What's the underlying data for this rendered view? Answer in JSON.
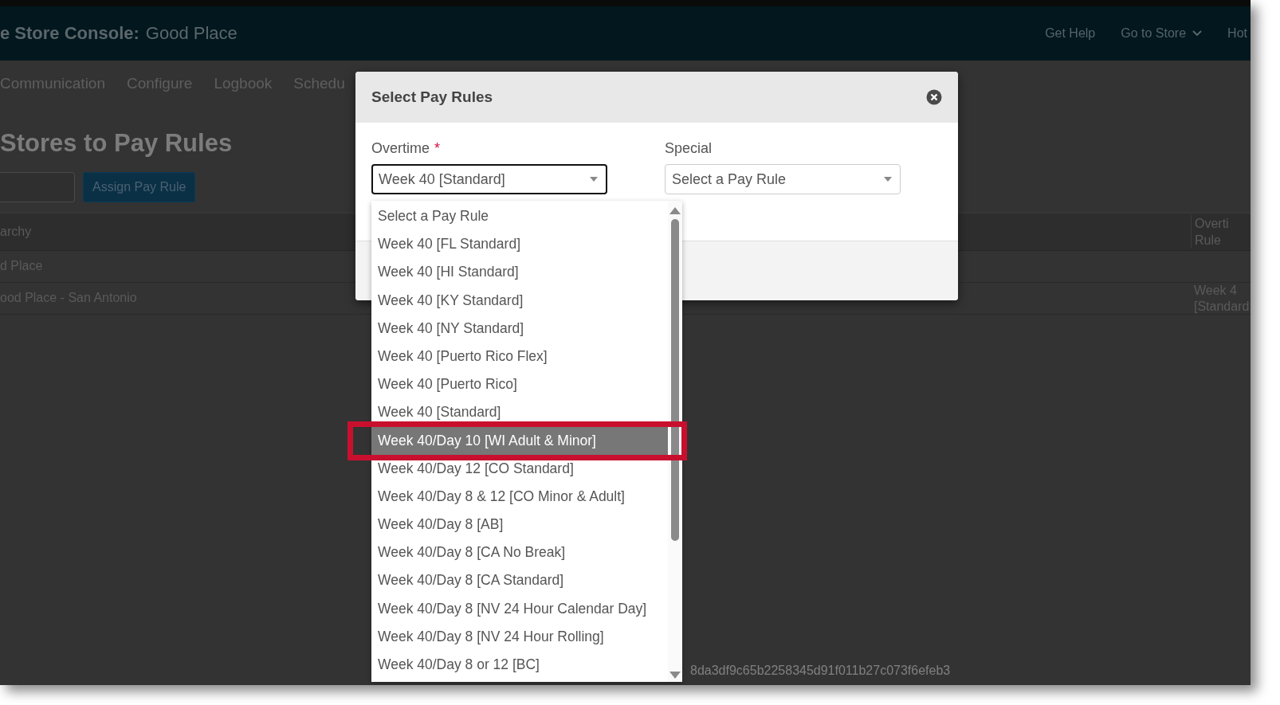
{
  "header": {
    "title_prefix": "e Store Console:",
    "title_store": "Good Place",
    "links": [
      {
        "label": "Get Help",
        "dropdown": false
      },
      {
        "label": "Go to Store",
        "dropdown": true
      },
      {
        "label": "Hot",
        "dropdown": false
      }
    ]
  },
  "nav": [
    {
      "label": "Communication"
    },
    {
      "label": "Configure"
    },
    {
      "label": "Logbook"
    },
    {
      "label": "Schedu"
    }
  ],
  "page_title": "Stores to Pay Rules",
  "assign_button": "Assign Pay Rule",
  "table": {
    "columns": [
      "archy",
      "Overti Rule"
    ],
    "rows": [
      {
        "name": "d Place"
      },
      {
        "name": "ood Place - San Antonio",
        "overtime_rule": "Week 4 [Standard"
      }
    ]
  },
  "footer_hash": "8da3df9c65b2258345d91f011b27c073f6efeb3",
  "modal": {
    "title": "Select Pay Rules",
    "fields": [
      {
        "label": "Overtime",
        "required_mark": "*",
        "value": "Week 40 [Standard]",
        "focused": true
      },
      {
        "label": "Special",
        "placeholder": "Select a Pay Rule",
        "focused": false
      }
    ],
    "options": [
      {
        "label": "Select a Pay Rule",
        "selected": false
      },
      {
        "label": "Week 40 [FL Standard]",
        "selected": false
      },
      {
        "label": "Week 40 [HI Standard]",
        "selected": false
      },
      {
        "label": "Week 40 [KY Standard]",
        "selected": false
      },
      {
        "label": "Week 40 [NY Standard]",
        "selected": false
      },
      {
        "label": "Week 40 [Puerto Rico Flex]",
        "selected": false
      },
      {
        "label": "Week 40 [Puerto Rico]",
        "selected": false
      },
      {
        "label": "Week 40 [Standard]",
        "selected": false
      },
      {
        "label": "Week 40/Day 10 [WI Adult & Minor]",
        "selected": true
      },
      {
        "label": "Week 40/Day 12 [CO Standard]",
        "selected": false
      },
      {
        "label": "Week 40/Day 8 & 12 [CO Minor & Adult]",
        "selected": false
      },
      {
        "label": "Week 40/Day 8 [AB]",
        "selected": false
      },
      {
        "label": "Week 40/Day 8 [CA No Break]",
        "selected": false
      },
      {
        "label": "Week 40/Day 8 [CA Standard]",
        "selected": false
      },
      {
        "label": "Week 40/Day 8 [NV 24 Hour Calendar Day]",
        "selected": false
      },
      {
        "label": "Week 40/Day 8 [NV 24 Hour Rolling]",
        "selected": false
      },
      {
        "label": "Week 40/Day 8 or 12 [BC]",
        "selected": false
      }
    ]
  }
}
